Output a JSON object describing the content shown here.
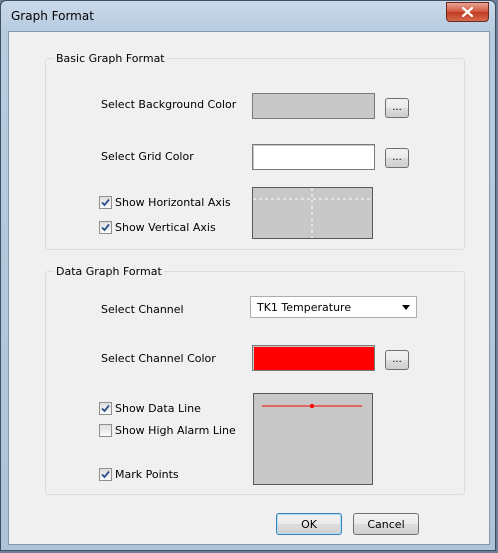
{
  "window": {
    "title": "Graph Format"
  },
  "basic": {
    "legend": "Basic Graph Format",
    "background_label": "Select Background Color",
    "background_color": "#c8c8c8",
    "grid_label": "Select Grid Color",
    "grid_color": "#ffffff",
    "browse_label": "...",
    "show_horizontal_axis": {
      "label": "Show Horizontal Axis",
      "checked": true
    },
    "show_vertical_axis": {
      "label": "Show Vertical Axis",
      "checked": true
    }
  },
  "data": {
    "legend": "Data Graph Format",
    "channel_label": "Select Channel",
    "channel_value": "TK1 Temperature",
    "channel_color_label": "Select Channel Color",
    "channel_color": "#ff0000",
    "browse_label": "...",
    "show_data_line": {
      "label": "Show Data Line",
      "checked": true
    },
    "show_high_alarm_line": {
      "label": "Show High Alarm Line",
      "checked": false
    },
    "mark_points": {
      "label": "Mark Points",
      "checked": true
    }
  },
  "footer": {
    "ok_label": "OK",
    "cancel_label": "Cancel"
  }
}
